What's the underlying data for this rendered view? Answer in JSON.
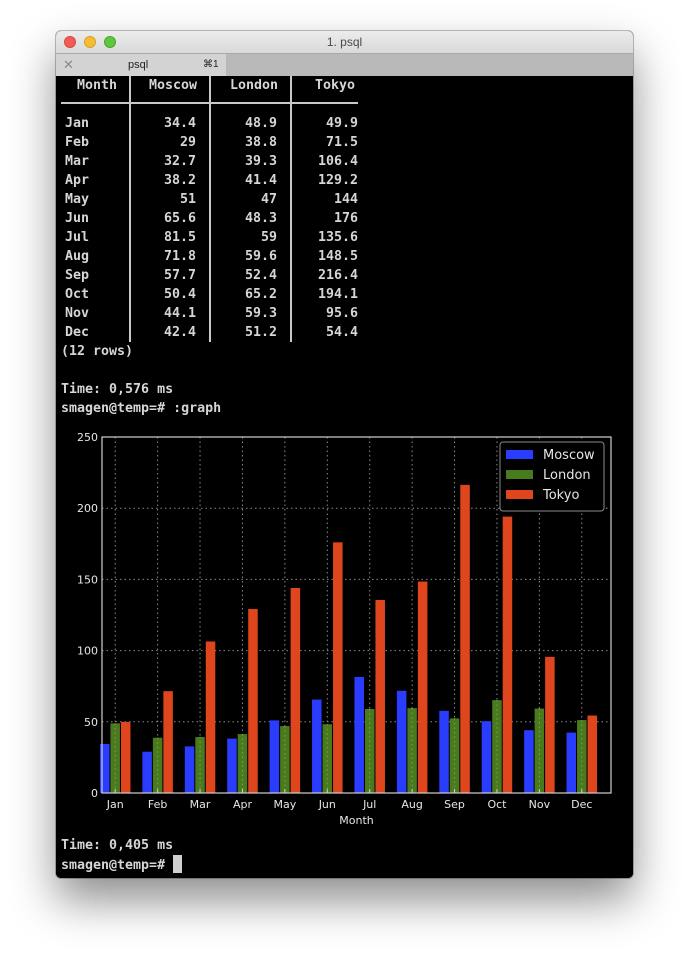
{
  "window": {
    "title": "1. psql",
    "tab": {
      "label": "psql",
      "shortcut": "⌘1",
      "close_icon": "close-icon"
    }
  },
  "table": {
    "columns": [
      "Month",
      "Moscow",
      "London",
      "Tokyo"
    ],
    "rows": [
      [
        "Jan",
        "34.4",
        "48.9",
        "49.9"
      ],
      [
        "Feb",
        "29",
        "38.8",
        "71.5"
      ],
      [
        "Mar",
        "32.7",
        "39.3",
        "106.4"
      ],
      [
        "Apr",
        "38.2",
        "41.4",
        "129.2"
      ],
      [
        "May",
        "51",
        "47",
        "144"
      ],
      [
        "Jun",
        "65.6",
        "48.3",
        "176"
      ],
      [
        "Jul",
        "81.5",
        "59",
        "135.6"
      ],
      [
        "Aug",
        "71.8",
        "59.6",
        "148.5"
      ],
      [
        "Sep",
        "57.7",
        "52.4",
        "216.4"
      ],
      [
        "Oct",
        "50.4",
        "65.2",
        "194.1"
      ],
      [
        "Nov",
        "44.1",
        "59.3",
        "95.6"
      ],
      [
        "Dec",
        "42.4",
        "51.2",
        "54.4"
      ]
    ],
    "row_count": "(12 rows)"
  },
  "terminal": {
    "time1": "Time: 0,576 ms",
    "prompt1": "smagen@temp=# ",
    "command1": ":graph",
    "time2": "Time: 0,405 ms",
    "prompt2": "smagen@temp=# "
  },
  "chart_data": {
    "type": "bar",
    "title": "",
    "xlabel": "Month",
    "ylabel": "",
    "categories": [
      "Jan",
      "Feb",
      "Mar",
      "Apr",
      "May",
      "Jun",
      "Jul",
      "Aug",
      "Sep",
      "Oct",
      "Nov",
      "Dec"
    ],
    "series": [
      {
        "name": "Moscow",
        "color": "#2a3dff",
        "values": [
          34.4,
          29,
          32.7,
          38.2,
          51,
          65.6,
          81.5,
          71.8,
          57.7,
          50.4,
          44.1,
          42.4
        ]
      },
      {
        "name": "London",
        "color": "#4a7a1e",
        "values": [
          48.9,
          38.8,
          39.3,
          41.4,
          47,
          48.3,
          59,
          59.6,
          52.4,
          65.2,
          59.3,
          51.2
        ]
      },
      {
        "name": "Tokyo",
        "color": "#e0461d",
        "values": [
          49.9,
          71.5,
          106.4,
          129.2,
          144,
          176,
          135.6,
          148.5,
          216.4,
          194.1,
          95.6,
          54.4
        ]
      }
    ],
    "ylim": [
      0,
      250
    ],
    "yticks": [
      0,
      50,
      100,
      150,
      200,
      250
    ],
    "grid": true,
    "legend": "top-right"
  }
}
